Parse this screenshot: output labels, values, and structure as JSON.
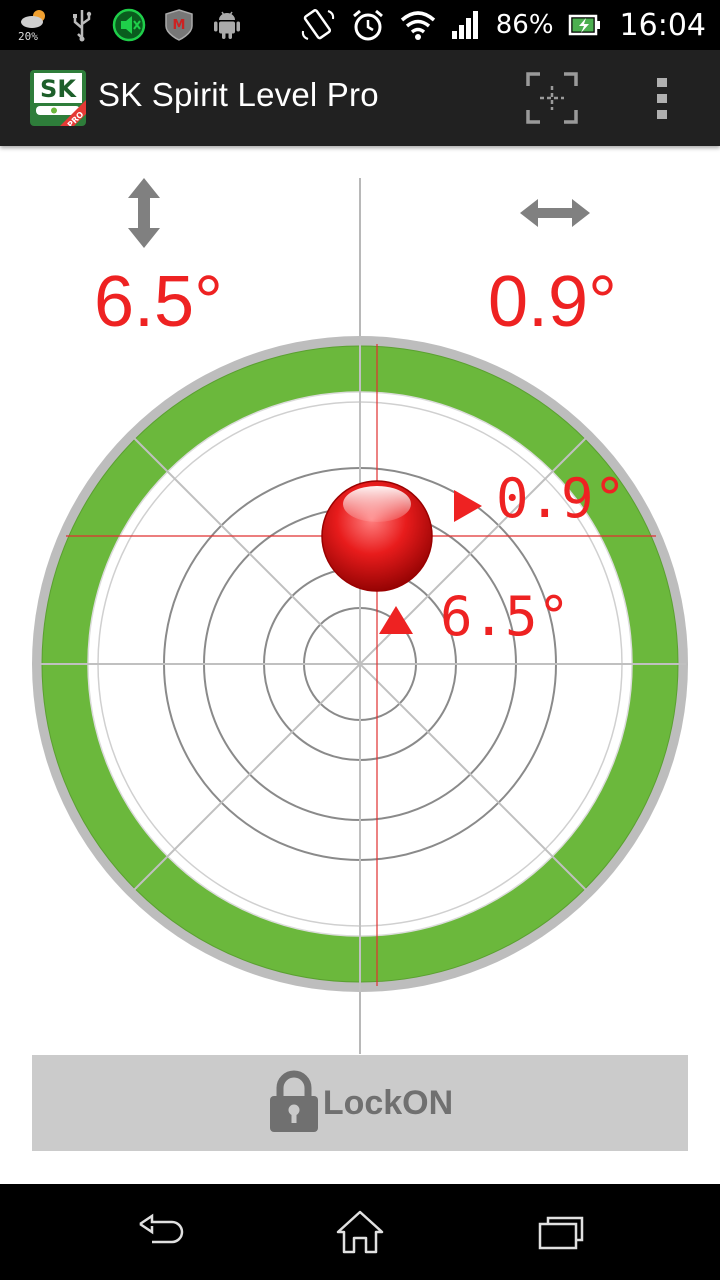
{
  "status_bar": {
    "weather_text": "20%",
    "battery_text": "86%",
    "clock": "16:04"
  },
  "action_bar": {
    "title": "SK Spirit Level Pro",
    "app_icon_text": "SK",
    "app_icon_badge": "PRO"
  },
  "level": {
    "vertical_angle": "6.5°",
    "horizontal_angle": "0.9°",
    "inline_horizontal": "0.9°",
    "inline_vertical": "6.5°"
  },
  "lock": {
    "label": "LockON"
  },
  "colors": {
    "accent_red": "#ee2222",
    "ring_green": "#6bb83c",
    "bezel_gray": "#bdbdbd",
    "action_bar": "#212121",
    "lock_button": "#cbcbcb"
  },
  "icons": {
    "vertical": "vertical-arrows-icon",
    "horizontal": "horizontal-arrows-icon",
    "calibrate": "calibrate-crosshair-icon",
    "overflow": "overflow-menu-icon",
    "lock": "padlock-icon"
  }
}
